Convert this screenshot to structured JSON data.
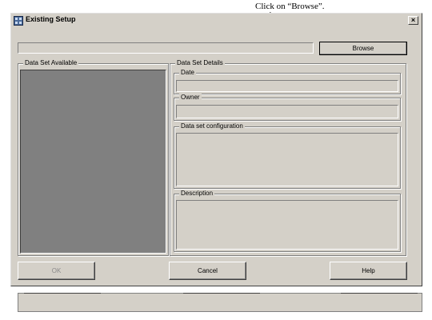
{
  "annotation": {
    "text": "Click on “Browse”."
  },
  "window": {
    "title": "Existing Setup",
    "close_label": "×",
    "path_value": "",
    "browse_label": "Browse"
  },
  "available": {
    "legend": "Data Set Available"
  },
  "details": {
    "legend": "Data Set Details",
    "date_label": "Date",
    "date_value": "",
    "owner_label": "Owner",
    "owner_value": "",
    "configuration_label": "Data set configuration",
    "configuration_value": "",
    "description_label": "Description",
    "description_value": ""
  },
  "buttons": {
    "ok": "OK",
    "cancel": "Cancel",
    "help": "Help"
  }
}
